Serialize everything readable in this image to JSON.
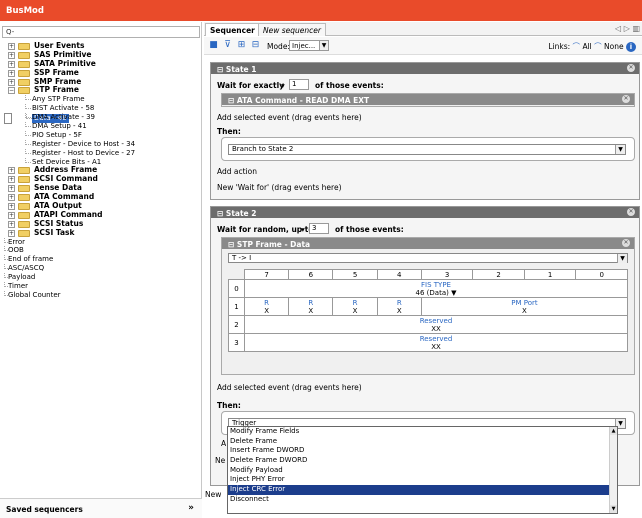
{
  "app": {
    "title": "BusMod"
  },
  "search": {
    "value": "Q-"
  },
  "tree": {
    "groups_top": [
      {
        "label": "User Events"
      },
      {
        "label": "SAS Primitive"
      },
      {
        "label": "SATA Primitive"
      },
      {
        "label": "SSP Frame"
      },
      {
        "label": "SMP Frame"
      }
    ],
    "stp": {
      "label": "STP Frame",
      "children": [
        "Any STP Frame",
        "BIST Activate - 58",
        "Data - 46",
        "DMA Activate - 39",
        "DMA Setup - 41",
        "PIO Setup - 5F",
        "Register - Device to Host - 34",
        "Register - Host to Device - 27",
        "Set Device Bits - A1"
      ],
      "selected": "Data - 46"
    },
    "groups_bottom": [
      {
        "label": "Address Frame"
      },
      {
        "label": "SCSI Command"
      },
      {
        "label": "Sense Data"
      },
      {
        "label": "ATA Command"
      },
      {
        "label": "ATA Output"
      },
      {
        "label": "ATAPI Command"
      },
      {
        "label": "SCSI Status"
      },
      {
        "label": "SCSI Task"
      }
    ],
    "leaves": [
      "Error",
      "OOB",
      "End of frame",
      "ASC/ASCQ",
      "Payload",
      "Timer",
      "Global Counter"
    ]
  },
  "saved": {
    "label": "Saved sequencers"
  },
  "tabs": [
    {
      "label": "Sequencer 1",
      "active": true
    },
    {
      "label": "New sequencer",
      "active": false
    }
  ],
  "toolbar": {
    "mode_label": "Mode:",
    "mode_value": "Injec...",
    "links_label": "Links:",
    "links_all": "All",
    "links_none": "None"
  },
  "state1": {
    "title": "State 1",
    "wait_label": "Wait for exactly",
    "count": "1",
    "of_events": "of those events:",
    "event_title": "ATA Command - READ DMA EXT",
    "add_selected": "Add selected event (drag events here)",
    "then_label": "Then:",
    "action_value": "Branch to State 2",
    "add_action": "Add action",
    "new_wait": "New 'Wait for' (drag events here)"
  },
  "state2": {
    "title": "State 2",
    "wait_label": "Wait for random, up to",
    "count": "3",
    "of_events": "of those events:",
    "event_title": "STP Frame - Data",
    "direction": "T -> I",
    "bit_headers": [
      "7",
      "6",
      "5",
      "4",
      "3",
      "2",
      "1",
      "0"
    ],
    "rows": [
      {
        "idx": "0",
        "cells": [
          {
            "name": "FIS TYPE",
            "val": "46 (Data) ▼"
          }
        ]
      },
      {
        "idx": "1",
        "cells": [
          {
            "name": "R",
            "val": "X"
          },
          {
            "name": "R",
            "val": "X"
          },
          {
            "name": "R",
            "val": "X"
          },
          {
            "name": "R",
            "val": "X"
          },
          {
            "name": "PM Port",
            "val": "X"
          }
        ]
      },
      {
        "idx": "2",
        "cells": [
          {
            "name": "Reserved",
            "val": "XX"
          }
        ]
      },
      {
        "idx": "3",
        "cells": [
          {
            "name": "Reserved",
            "val": "XX"
          }
        ]
      }
    ],
    "add_selected": "Add selected event (drag events here)",
    "then_label": "Then:",
    "action_value": "Trigger",
    "add_prefix": "A",
    "ne_prefix": "Ne",
    "new_prefix": "New "
  },
  "dropdown": {
    "options": [
      "Modify Frame Fields",
      "Delete Frame",
      "Insert Frame DWORD",
      "Delete Frame DWORD",
      "Modify Payload",
      "Inject PHY Error",
      "Inject CRC Error",
      "Disconnect"
    ],
    "highlighted": "Inject CRC Error"
  },
  "colors": {
    "title_bar": "#e94b2a",
    "selection": "#2a67c2",
    "state_header": "#6d6d6d",
    "dropdown_highlight": "#1c3d8c"
  }
}
